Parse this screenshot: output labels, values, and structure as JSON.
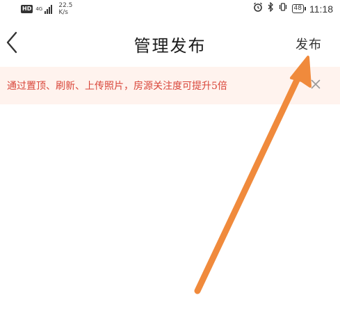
{
  "status_bar": {
    "hd_label": "HD",
    "network_type": "4G",
    "speed_value": "22.5",
    "speed_unit": "K/s",
    "battery": "48",
    "time": "11:18",
    "icons": [
      "alarm-icon",
      "bluetooth-icon",
      "vibrate-icon",
      "battery-icon"
    ]
  },
  "nav": {
    "back_icon": "chevron-left-icon",
    "title": "管理发布",
    "publish_label": "发布"
  },
  "banner": {
    "text": "通过置顶、刷新、上传照片，房源关注度可提升5倍",
    "close_icon": "close-icon"
  },
  "colors": {
    "banner_bg": "#fff3ee",
    "banner_text": "#d9463a",
    "annotation_arrow": "#f08a3c"
  }
}
